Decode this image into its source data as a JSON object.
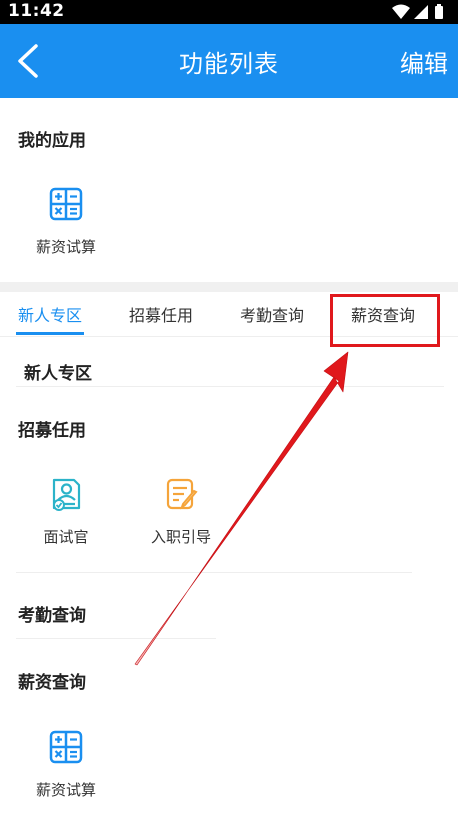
{
  "status_bar": {
    "time": "11:42"
  },
  "app_bar": {
    "title": "功能列表",
    "edit_label": "编辑"
  },
  "my_apps": {
    "title": "我的应用",
    "items": [
      {
        "label": "薪资试算",
        "icon": "calculator-icon"
      }
    ]
  },
  "tabs": [
    {
      "label": "新人专区",
      "active": true
    },
    {
      "label": "招募任用",
      "active": false
    },
    {
      "label": "考勤查询",
      "active": false
    },
    {
      "label": "薪资查询",
      "active": false
    }
  ],
  "sections": [
    {
      "title": "新人专区",
      "items": []
    },
    {
      "title": "招募任用",
      "items": [
        {
          "label": "面试官",
          "icon": "interviewer-icon"
        },
        {
          "label": "入职引导",
          "icon": "onboarding-guide-icon"
        }
      ]
    },
    {
      "title": "考勤查询",
      "items": []
    },
    {
      "title": "薪资查询",
      "items": [
        {
          "label": "薪资试算",
          "icon": "calculator-icon"
        }
      ]
    }
  ],
  "colors": {
    "primary": "#1a8ff0",
    "highlight": "#e0181c",
    "orange_icon": "#f5a43a",
    "teal_icon": "#2bb3c9"
  }
}
